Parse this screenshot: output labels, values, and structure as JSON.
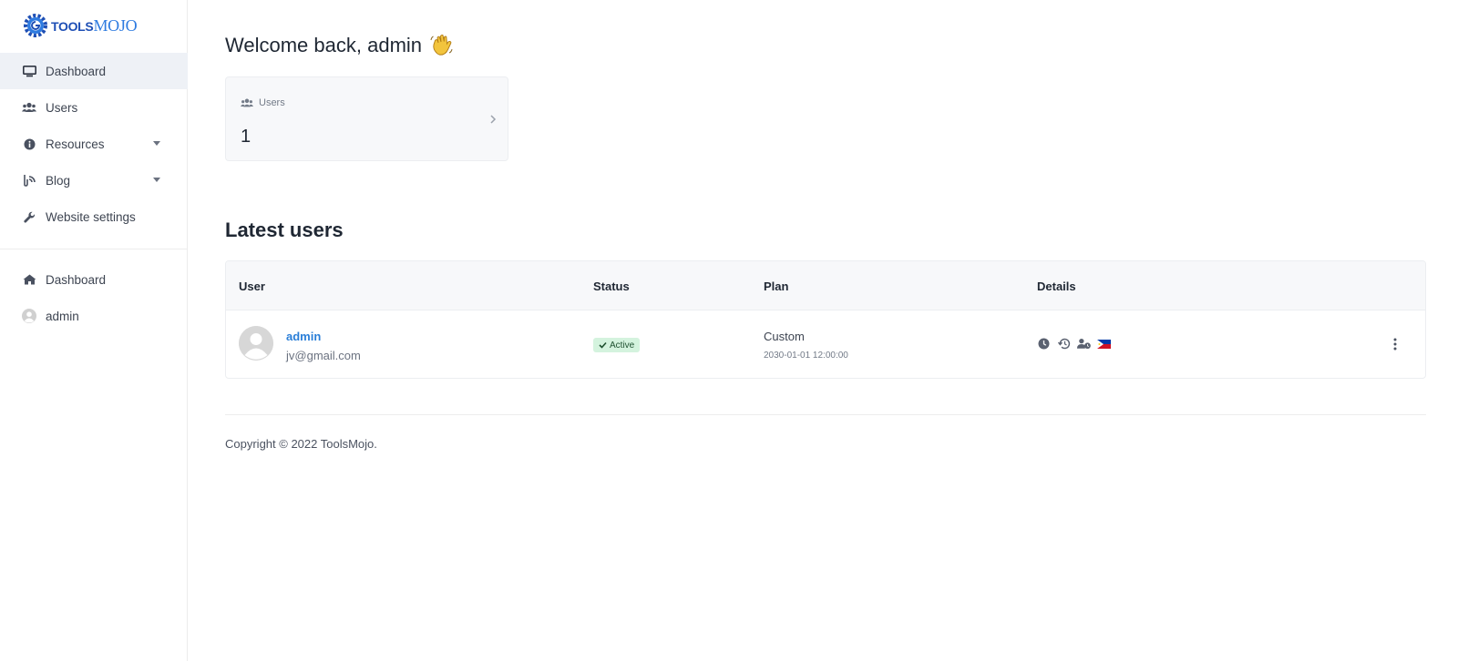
{
  "brand": {
    "part1": "TOOLS",
    "part2": "MOJO"
  },
  "sidebar": {
    "primary": [
      {
        "label": "Dashboard",
        "icon": "monitor-icon",
        "active": true
      },
      {
        "label": "Users",
        "icon": "users-icon"
      },
      {
        "label": "Resources",
        "icon": "info-circle-icon",
        "dropdown": true
      },
      {
        "label": "Blog",
        "icon": "blog-icon",
        "dropdown": true
      },
      {
        "label": "Website settings",
        "icon": "wrench-icon"
      }
    ],
    "secondary": [
      {
        "label": "Dashboard",
        "icon": "home-icon"
      },
      {
        "label": "admin",
        "icon": "avatar-icon"
      }
    ]
  },
  "main": {
    "welcome": "Welcome back, admin",
    "stats": {
      "label": "Users",
      "value": "1"
    },
    "latest_title": "Latest users",
    "table": {
      "headers": [
        "User",
        "Status",
        "Plan",
        "Details"
      ],
      "rows": [
        {
          "name": "admin",
          "email": "jv@gmail.com",
          "status": "Active",
          "plan": "Custom",
          "plan_expiry": "2030-01-01 12:00:00",
          "details_icons": [
            "clock-icon",
            "history-icon",
            "user-clock-icon",
            "philippines-flag-icon"
          ]
        }
      ]
    },
    "footer": "Copyright © 2022 ToolsMojo."
  },
  "colors": {
    "accent": "#2b7fd8",
    "brand_dark": "#1e4fb5",
    "active_bg": "#eef1f6",
    "badge_bg": "#d4f3de"
  }
}
